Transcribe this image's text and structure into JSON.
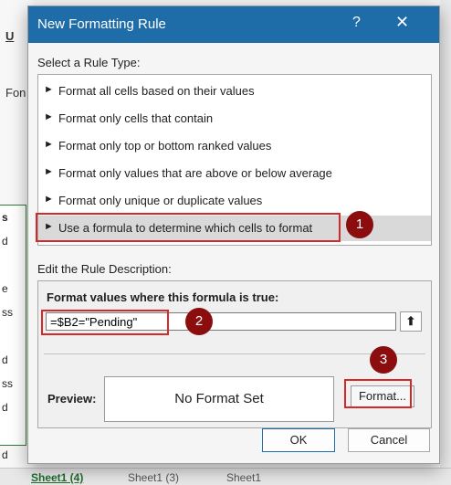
{
  "background": {
    "left_letters": [
      "U",
      "Fon",
      "s",
      "d",
      "e",
      "ss",
      "d",
      "ss",
      "d",
      "d"
    ],
    "sheet_tabs": [
      "Sheet1 (4)",
      "Sheet1 (3)",
      "Sheet1"
    ]
  },
  "dialog": {
    "title": "New Formatting Rule",
    "help_label": "?",
    "close_label": "✕",
    "rule_type_label": "Select a Rule Type:",
    "rule_types": [
      "Format all cells based on their values",
      "Format only cells that contain",
      "Format only top or bottom ranked values",
      "Format only values that are above or below average",
      "Format only unique or duplicate values",
      "Use a formula to determine which cells to format"
    ],
    "selected_rule_index": 5,
    "rule_arrow": "►",
    "description_label": "Edit the Rule Description:",
    "formula_label": "Format values where this formula is true:",
    "formula_value": "=$B2=\"Pending\"",
    "collapse_icon": "⬆",
    "preview_label": "Preview:",
    "preview_text": "No Format Set",
    "format_button": "Format...",
    "ok_button": "OK",
    "cancel_button": "Cancel"
  },
  "callouts": [
    "1",
    "2",
    "3"
  ],
  "colors": {
    "title_bar": "#1e6ca8",
    "callout": "#8b0d0d",
    "highlight_box": "#d62828"
  }
}
